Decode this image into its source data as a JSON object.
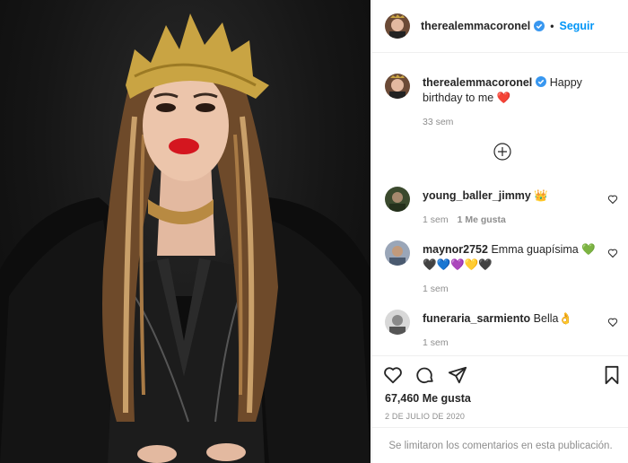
{
  "post": {
    "author": "therealemmacoronel",
    "follow_label": "Seguir",
    "dot": "•",
    "caption_text": "Happy birthday to me",
    "caption_emoji": "❤️",
    "caption_age": "33 sem"
  },
  "comments": [
    {
      "user": "young_baller_jimmy",
      "text": "👑",
      "age": "1 sem",
      "likes_label": "1 Me gusta"
    },
    {
      "user": "maynor2752",
      "text": "Emma guapísima 💚🖤💙💜💛🖤",
      "age": "1 sem",
      "likes_label": ""
    },
    {
      "user": "funeraria_sarmiento",
      "text": "Bella👌",
      "age": "1 sem",
      "likes_label": ""
    }
  ],
  "likes": "67,460 Me gusta",
  "date": "2 DE JULIO DE 2020",
  "footer": "Se limitaron los comentarios en esta publicación.",
  "icons": [
    "verified-badge-icon",
    "heart-icon",
    "comment-icon",
    "share-icon",
    "bookmark-icon",
    "add-circle-icon"
  ],
  "colors": {
    "accent": "#0095f6",
    "verified": "#3897f0",
    "muted": "#8e8e8e",
    "crown": "#c9a443",
    "lips": "#d4161f"
  }
}
